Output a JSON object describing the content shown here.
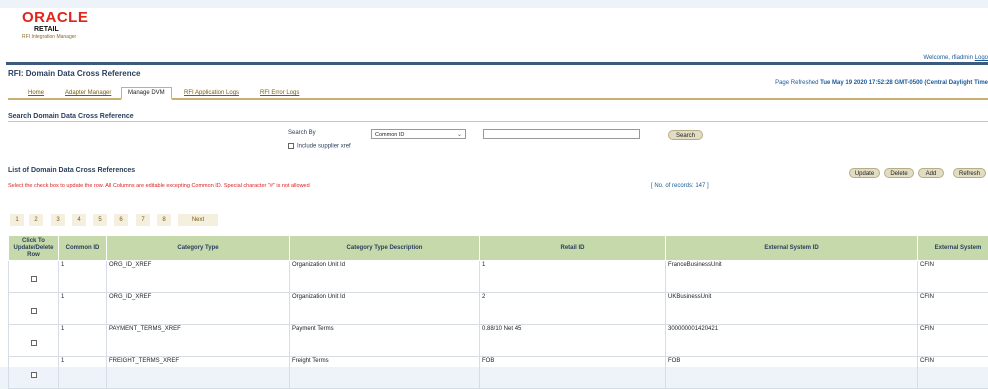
{
  "header": {
    "logo": {
      "brand": "ORACLE",
      "product": "RETAIL",
      "subtitle": "RFI Integration Manager"
    },
    "welcome": "Welcome, rfiadmin",
    "logout": "Logo"
  },
  "page": {
    "title": "RFI: Domain Data Cross Reference",
    "refreshed_label": "Page Refreshed",
    "refreshed_value": "Tue May 19 2020 17:52:28 GMT-0500 (Central Daylight Time"
  },
  "tabs": [
    {
      "label": "Home",
      "active": false
    },
    {
      "label": "Adapter Manager",
      "active": false
    },
    {
      "label": "Manage DVM",
      "active": true
    },
    {
      "label": "RFI Application Logs",
      "active": false
    },
    {
      "label": "RFI Error Logs",
      "active": false
    }
  ],
  "search": {
    "section_title": "Search Domain Data Cross Reference",
    "label": "Search By",
    "selected_option": "Common ID",
    "text_value": "",
    "button": "Search",
    "include_label": "Include supplier xref"
  },
  "list": {
    "title": "List of Domain Data Cross References",
    "hint": "Select the check box to update the row. All Columns are editable excepting Common ID. Special character \"#\" is not allowed",
    "records": "[ No. of records: 147 ]",
    "buttons": {
      "update": "Update",
      "delete": "Delete",
      "add": "Add",
      "refresh": "Refresh"
    }
  },
  "pager": [
    "1",
    "2",
    "3",
    "4",
    "5",
    "6",
    "7",
    "8",
    "Next"
  ],
  "table": {
    "headers": {
      "click": [
        "Click To",
        "Update/Delete",
        "Row"
      ],
      "common_id": "Common ID",
      "category_type": "Category Type",
      "category_desc": "Category Type Description",
      "retail_id": "Retail ID",
      "external_id": "External System ID",
      "external_system": "External System"
    },
    "rows": [
      {
        "common_id": "1",
        "category_type": "ORG_ID_XREF",
        "category_desc": "Organization Unit Id",
        "retail_id": "1",
        "external_id": "FranceBusinessUnit",
        "external_system": "CFIN"
      },
      {
        "common_id": "1",
        "category_type": "ORG_ID_XREF",
        "category_desc": "Organization Unit Id",
        "retail_id": "2",
        "external_id": "UKBusinessUnit",
        "external_system": "CFIN"
      },
      {
        "common_id": "1",
        "category_type": "PAYMENT_TERMS_XREF",
        "category_desc": "Payment Terms",
        "retail_id": "0.88/10 Net 45",
        "external_id": "300000001420421",
        "external_system": "CFIN"
      },
      {
        "common_id": "1",
        "category_type": "FREIGHT_TERMS_XREF",
        "category_desc": "Freight Terms",
        "retail_id": "FOB",
        "external_id": "FOB",
        "external_system": "CFIN"
      }
    ]
  }
}
